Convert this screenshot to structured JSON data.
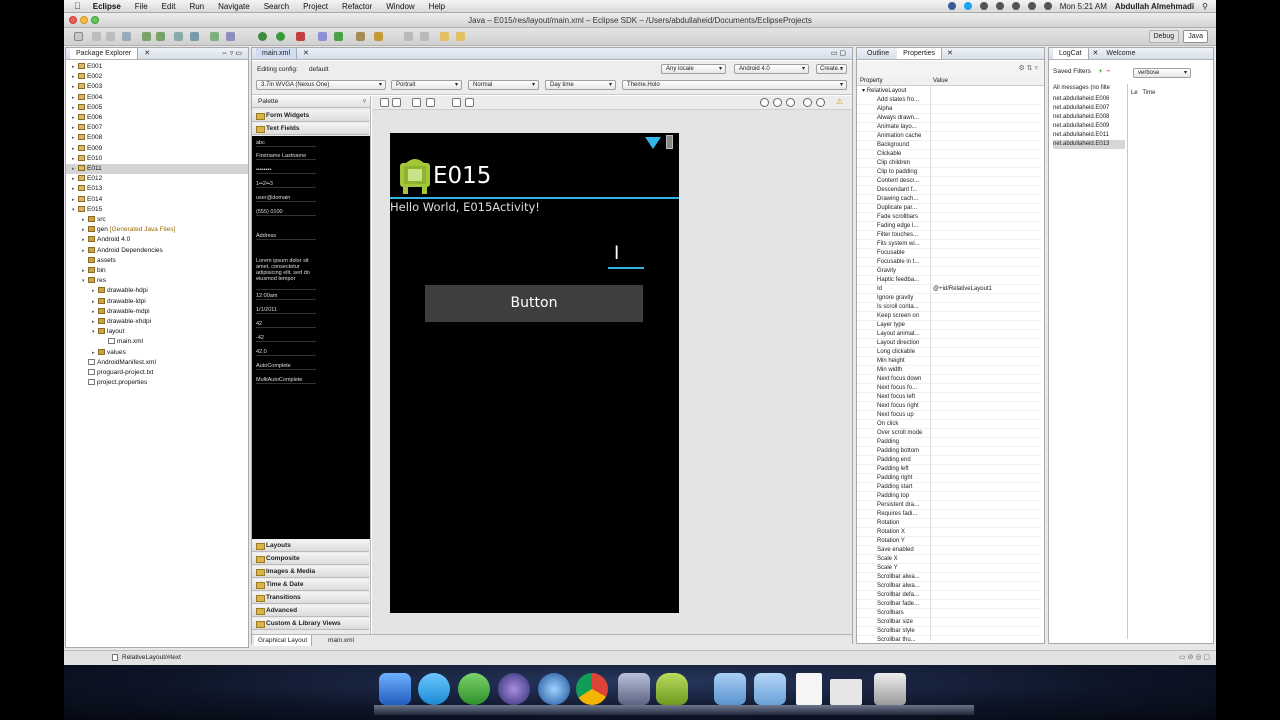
{
  "menubar": {
    "app": "Eclipse",
    "items": [
      "File",
      "Edit",
      "Run",
      "Navigate",
      "Search",
      "Project",
      "Refactor",
      "Window",
      "Help"
    ],
    "clock": "Mon 5:21 AM",
    "user": "Abdullah Almehmadi"
  },
  "window": {
    "title": "Java – E015/res/layout/main.xml – Eclipse SDK – /Users/abdullaheid/Documents/EclipseProjects",
    "perspectives": [
      "Debug",
      "Java"
    ]
  },
  "package_explorer": {
    "tab": "Package Explorer",
    "rows": [
      {
        "label": "E001",
        "depth": 0,
        "toggle": "▸",
        "kind": "project"
      },
      {
        "label": "E002",
        "depth": 0,
        "toggle": "▸",
        "kind": "project"
      },
      {
        "label": "E003",
        "depth": 0,
        "toggle": "▸",
        "kind": "project"
      },
      {
        "label": "E004",
        "depth": 0,
        "toggle": "▸",
        "kind": "project"
      },
      {
        "label": "E005",
        "depth": 0,
        "toggle": "▸",
        "kind": "project"
      },
      {
        "label": "E006",
        "depth": 0,
        "toggle": "▸",
        "kind": "project"
      },
      {
        "label": "E007",
        "depth": 0,
        "toggle": "▸",
        "kind": "project"
      },
      {
        "label": "E008",
        "depth": 0,
        "toggle": "▸",
        "kind": "project"
      },
      {
        "label": "E009",
        "depth": 0,
        "toggle": "▸",
        "kind": "project"
      },
      {
        "label": "E010",
        "depth": 0,
        "toggle": "▸",
        "kind": "project"
      },
      {
        "label": "E011",
        "depth": 0,
        "toggle": "▸",
        "kind": "project",
        "selected": true
      },
      {
        "label": "E012",
        "depth": 0,
        "toggle": "▸",
        "kind": "project"
      },
      {
        "label": "E013",
        "depth": 0,
        "toggle": "▸",
        "kind": "project"
      },
      {
        "label": "E014",
        "depth": 0,
        "toggle": "▸",
        "kind": "project"
      },
      {
        "label": "E015",
        "depth": 0,
        "toggle": "▾",
        "kind": "project"
      },
      {
        "label": "src",
        "depth": 1,
        "toggle": "▸",
        "kind": "folder"
      },
      {
        "label": "gen",
        "depth": 1,
        "toggle": "▸",
        "kind": "folder",
        "suffix": "[Generated Java Files]"
      },
      {
        "label": "Android 4.0",
        "depth": 1,
        "toggle": "▸",
        "kind": "lib"
      },
      {
        "label": "Android Dependencies",
        "depth": 1,
        "toggle": "▸",
        "kind": "lib"
      },
      {
        "label": "assets",
        "depth": 1,
        "toggle": "",
        "kind": "folder"
      },
      {
        "label": "bin",
        "depth": 1,
        "toggle": "▸",
        "kind": "folder"
      },
      {
        "label": "res",
        "depth": 1,
        "toggle": "▾",
        "kind": "folder"
      },
      {
        "label": "drawable-hdpi",
        "depth": 2,
        "toggle": "▸",
        "kind": "folder"
      },
      {
        "label": "drawable-ldpi",
        "depth": 2,
        "toggle": "▸",
        "kind": "folder"
      },
      {
        "label": "drawable-mdpi",
        "depth": 2,
        "toggle": "▸",
        "kind": "folder"
      },
      {
        "label": "drawable-xhdpi",
        "depth": 2,
        "toggle": "▸",
        "kind": "folder"
      },
      {
        "label": "layout",
        "depth": 2,
        "toggle": "▾",
        "kind": "folder"
      },
      {
        "label": "main.xml",
        "depth": 3,
        "toggle": "",
        "kind": "file"
      },
      {
        "label": "values",
        "depth": 2,
        "toggle": "▸",
        "kind": "folder"
      },
      {
        "label": "AndroidManifest.xml",
        "depth": 1,
        "toggle": "",
        "kind": "file"
      },
      {
        "label": "proguard-project.txt",
        "depth": 1,
        "toggle": "",
        "kind": "file"
      },
      {
        "label": "project.properties",
        "depth": 1,
        "toggle": "",
        "kind": "file"
      }
    ]
  },
  "editor": {
    "tab": "main.xml",
    "config_label": "Editing config:",
    "config_value": "default",
    "locale": "Any locale",
    "api": "Android 4.0",
    "create_label": "Create...",
    "device": "3.7in WVGA (Nexus One)",
    "orientation": "Portrait",
    "mode": "Normal",
    "dock": "Day time",
    "theme": "Theme.Holo",
    "palette_title": "Palette",
    "palette_open": [
      "Form Widgets",
      "Text Fields"
    ],
    "text_fields": [
      "abc",
      "Firstname Lastname",
      "••••••••",
      "1••2••3",
      "user@domain",
      "(555) 0100",
      "Address",
      "Lorem ipsum dolor sit amet, consectetur adipisicing elit, sed do eiusmod tempor",
      "12:00am",
      "1/1/2011",
      "42",
      "-42",
      "42.0",
      "AutoComplete",
      "MultiAutoComplete"
    ],
    "palette_categories": [
      "Layouts",
      "Composite",
      "Images & Media",
      "Time & Date",
      "Transitions",
      "Advanced",
      "Custom & Library Views"
    ],
    "bottom_tabs": [
      "Graphical Layout",
      "main.xml"
    ],
    "app_title": "E015",
    "hello_text": "Hello World, E015Activity!",
    "button_label": "Button",
    "edit_text_cursor": "I"
  },
  "properties": {
    "tabs": [
      "Outline",
      "Properties"
    ],
    "col_property": "Property",
    "col_value": "Value",
    "root": "RelativeLayout",
    "rows": [
      {
        "name": "Add states fro...",
        "value": ""
      },
      {
        "name": "Alpha",
        "value": ""
      },
      {
        "name": "Always drawn...",
        "value": ""
      },
      {
        "name": "Animate layo...",
        "value": ""
      },
      {
        "name": "Animation cache",
        "value": ""
      },
      {
        "name": "Background",
        "value": ""
      },
      {
        "name": "Clickable",
        "value": ""
      },
      {
        "name": "Clip children",
        "value": ""
      },
      {
        "name": "Clip to padding",
        "value": ""
      },
      {
        "name": "Content descr...",
        "value": ""
      },
      {
        "name": "Descendant f...",
        "value": ""
      },
      {
        "name": "Drawing cach...",
        "value": ""
      },
      {
        "name": "Duplicate par...",
        "value": ""
      },
      {
        "name": "Fade scrollbars",
        "value": ""
      },
      {
        "name": "Fading edge l...",
        "value": ""
      },
      {
        "name": "Filter touches...",
        "value": ""
      },
      {
        "name": "Fits system wi...",
        "value": ""
      },
      {
        "name": "Focusable",
        "value": ""
      },
      {
        "name": "Focusable in t...",
        "value": ""
      },
      {
        "name": "Gravity",
        "value": ""
      },
      {
        "name": "Haptic feedba...",
        "value": ""
      },
      {
        "name": "Id",
        "value": "@+id/RelativeLayout1"
      },
      {
        "name": "Ignore gravity",
        "value": ""
      },
      {
        "name": "Is scroll conta...",
        "value": ""
      },
      {
        "name": "Keep screen on",
        "value": ""
      },
      {
        "name": "Layer type",
        "value": ""
      },
      {
        "name": "Layout animat...",
        "value": ""
      },
      {
        "name": "Layout direction",
        "value": ""
      },
      {
        "name": "Long clickable",
        "value": ""
      },
      {
        "name": "Min height",
        "value": ""
      },
      {
        "name": "Min width",
        "value": ""
      },
      {
        "name": "Next focus down",
        "value": ""
      },
      {
        "name": "Next focus fo...",
        "value": ""
      },
      {
        "name": "Next focus left",
        "value": ""
      },
      {
        "name": "Next focus right",
        "value": ""
      },
      {
        "name": "Next focus up",
        "value": ""
      },
      {
        "name": "On click",
        "value": ""
      },
      {
        "name": "Over scroll mode",
        "value": ""
      },
      {
        "name": "Padding",
        "value": ""
      },
      {
        "name": "Padding bottom",
        "value": ""
      },
      {
        "name": "Padding end",
        "value": ""
      },
      {
        "name": "Padding left",
        "value": ""
      },
      {
        "name": "Padding right",
        "value": ""
      },
      {
        "name": "Padding start",
        "value": ""
      },
      {
        "name": "Padding top",
        "value": ""
      },
      {
        "name": "Persistent dra...",
        "value": ""
      },
      {
        "name": "Requires fadi...",
        "value": ""
      },
      {
        "name": "Rotation",
        "value": ""
      },
      {
        "name": "Rotation X",
        "value": ""
      },
      {
        "name": "Rotation Y",
        "value": ""
      },
      {
        "name": "Save enabled",
        "value": ""
      },
      {
        "name": "Scale X",
        "value": ""
      },
      {
        "name": "Scale Y",
        "value": ""
      },
      {
        "name": "Scrollbar alwa...",
        "value": ""
      },
      {
        "name": "Scrollbar alwa...",
        "value": ""
      },
      {
        "name": "Scrollbar defa...",
        "value": ""
      },
      {
        "name": "Scrollbar fade...",
        "value": ""
      },
      {
        "name": "Scrollbars",
        "value": ""
      },
      {
        "name": "Scrollbar size",
        "value": ""
      },
      {
        "name": "Scrollbar style",
        "value": ""
      },
      {
        "name": "Scrollbar thu...",
        "value": ""
      }
    ]
  },
  "logcat": {
    "tabs": [
      "LogCat",
      "Welcome"
    ],
    "saved_filters_label": "Saved Filters",
    "level": "verbose",
    "col_level": "Le",
    "col_time": "Time",
    "filters": [
      "All messages (no filte",
      "net.abdullaheid.E006",
      "net.abdullaheid.E007",
      "net.abdullaheid.E008",
      "net.abdullaheid.E009",
      "net.abdullaheid.E011",
      "net.abdullaheid.E013"
    ]
  },
  "statusbar": {
    "path": "RelativeLayout/#text"
  },
  "colors": {
    "holo_blue": "#33b5e5",
    "selection": "#c6d6ec",
    "android_green": "#a4c639"
  }
}
